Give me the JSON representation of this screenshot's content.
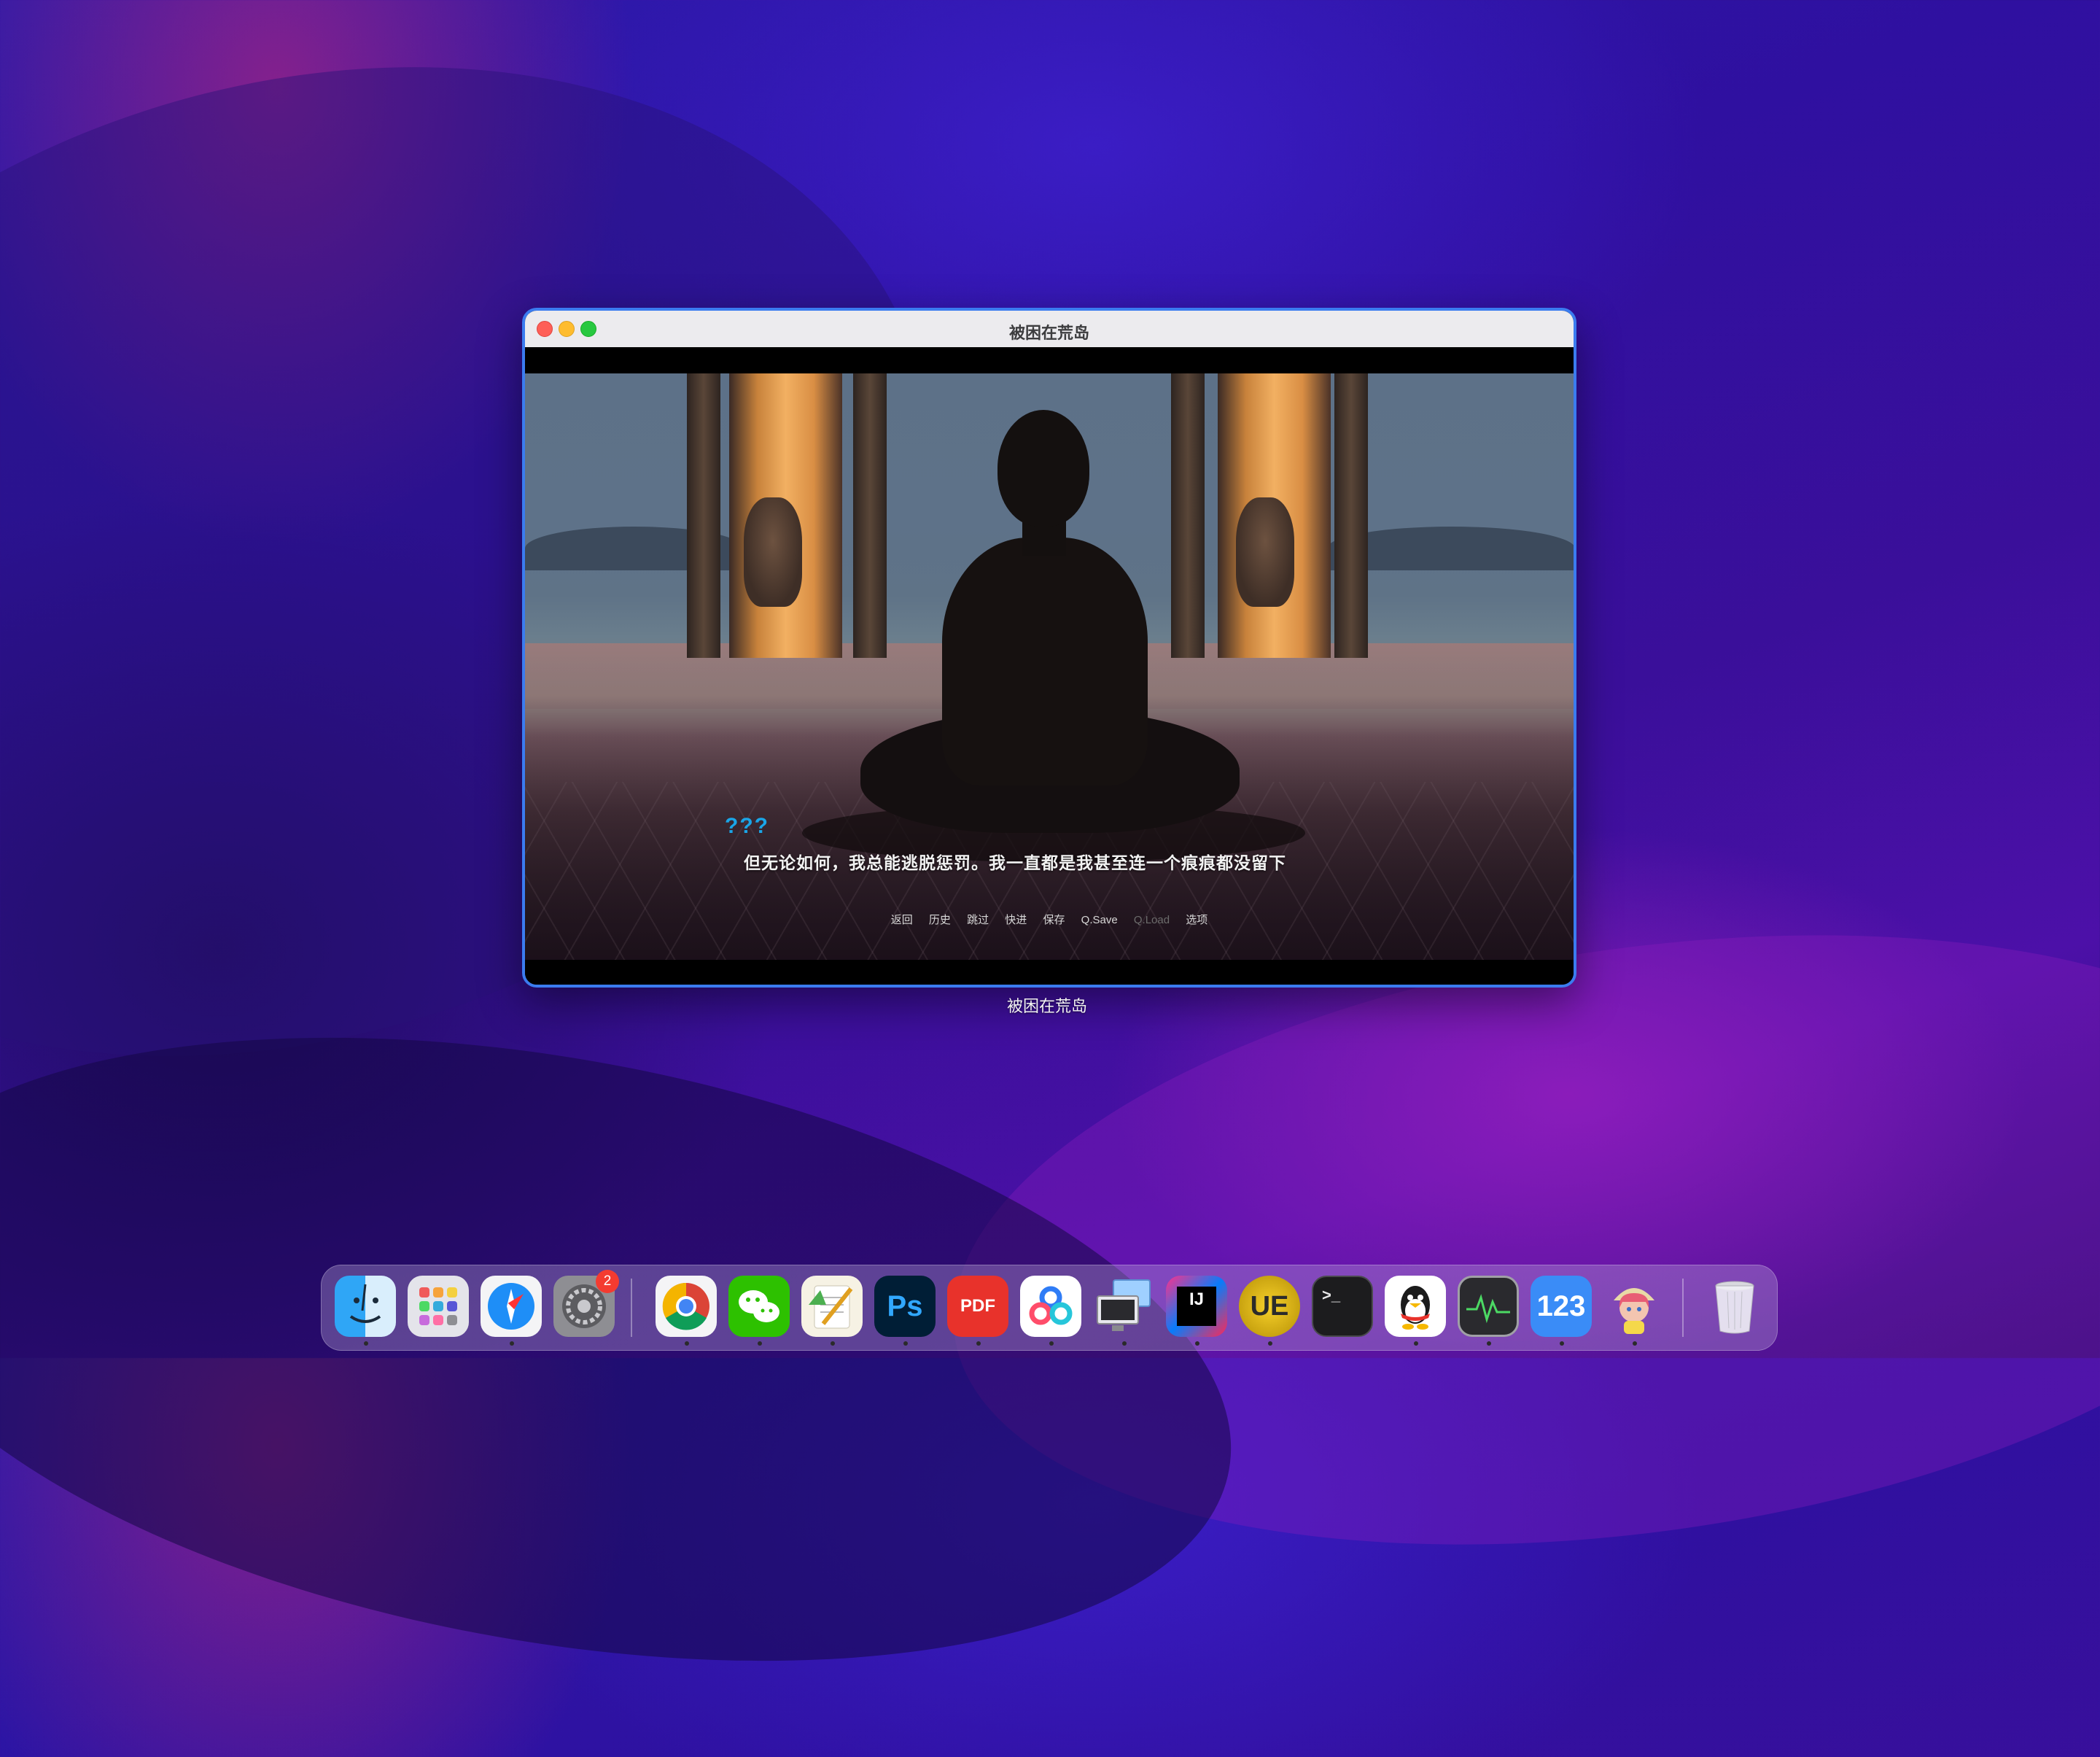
{
  "window": {
    "title": "被困在荒岛",
    "label_below": "被困在荒岛"
  },
  "game": {
    "speaker": "???",
    "dialogue": "但无论如何，我总能逃脱惩罚。我一直都是我甚至连一个痕痕都没留下",
    "quick_menu": [
      "返回",
      "历史",
      "跳过",
      "快进",
      "保存",
      "Q.Save",
      "Q.Load",
      "选项"
    ]
  },
  "dock": {
    "apps": [
      {
        "name": "finder-icon",
        "running": true
      },
      {
        "name": "launchpad-icon",
        "running": false
      },
      {
        "name": "safari-icon",
        "running": true
      },
      {
        "name": "system-settings-icon",
        "running": false,
        "badge": "2"
      },
      {
        "name": "chrome-icon",
        "running": true
      },
      {
        "name": "wechat-icon",
        "running": true
      },
      {
        "name": "textedit-icon",
        "running": true
      },
      {
        "name": "photoshop-icon",
        "running": true
      },
      {
        "name": "pdf-expert-icon",
        "running": true
      },
      {
        "name": "baidu-netdisk-icon",
        "running": true
      },
      {
        "name": "screen-sharing-icon",
        "running": true
      },
      {
        "name": "intellij-idea-icon",
        "running": true
      },
      {
        "name": "ultraedit-icon",
        "running": true
      },
      {
        "name": "terminal-icon",
        "running": false
      },
      {
        "name": "qq-icon",
        "running": true
      },
      {
        "name": "activity-monitor-icon",
        "running": true
      },
      {
        "name": "123-pan-icon",
        "running": true
      },
      {
        "name": "game-app-icon",
        "running": true
      },
      {
        "name": "trash-icon",
        "running": false
      }
    ],
    "labels": {
      "photoshop": "Ps",
      "pdf": "PDF",
      "intellij": "IJ",
      "ultraedit": "UE",
      "terminal": ">_",
      "pan123": "123"
    }
  },
  "colors": {
    "window_border": "#3b7cf0",
    "speaker": "#1aa6e8",
    "badge": "#f43b30"
  }
}
